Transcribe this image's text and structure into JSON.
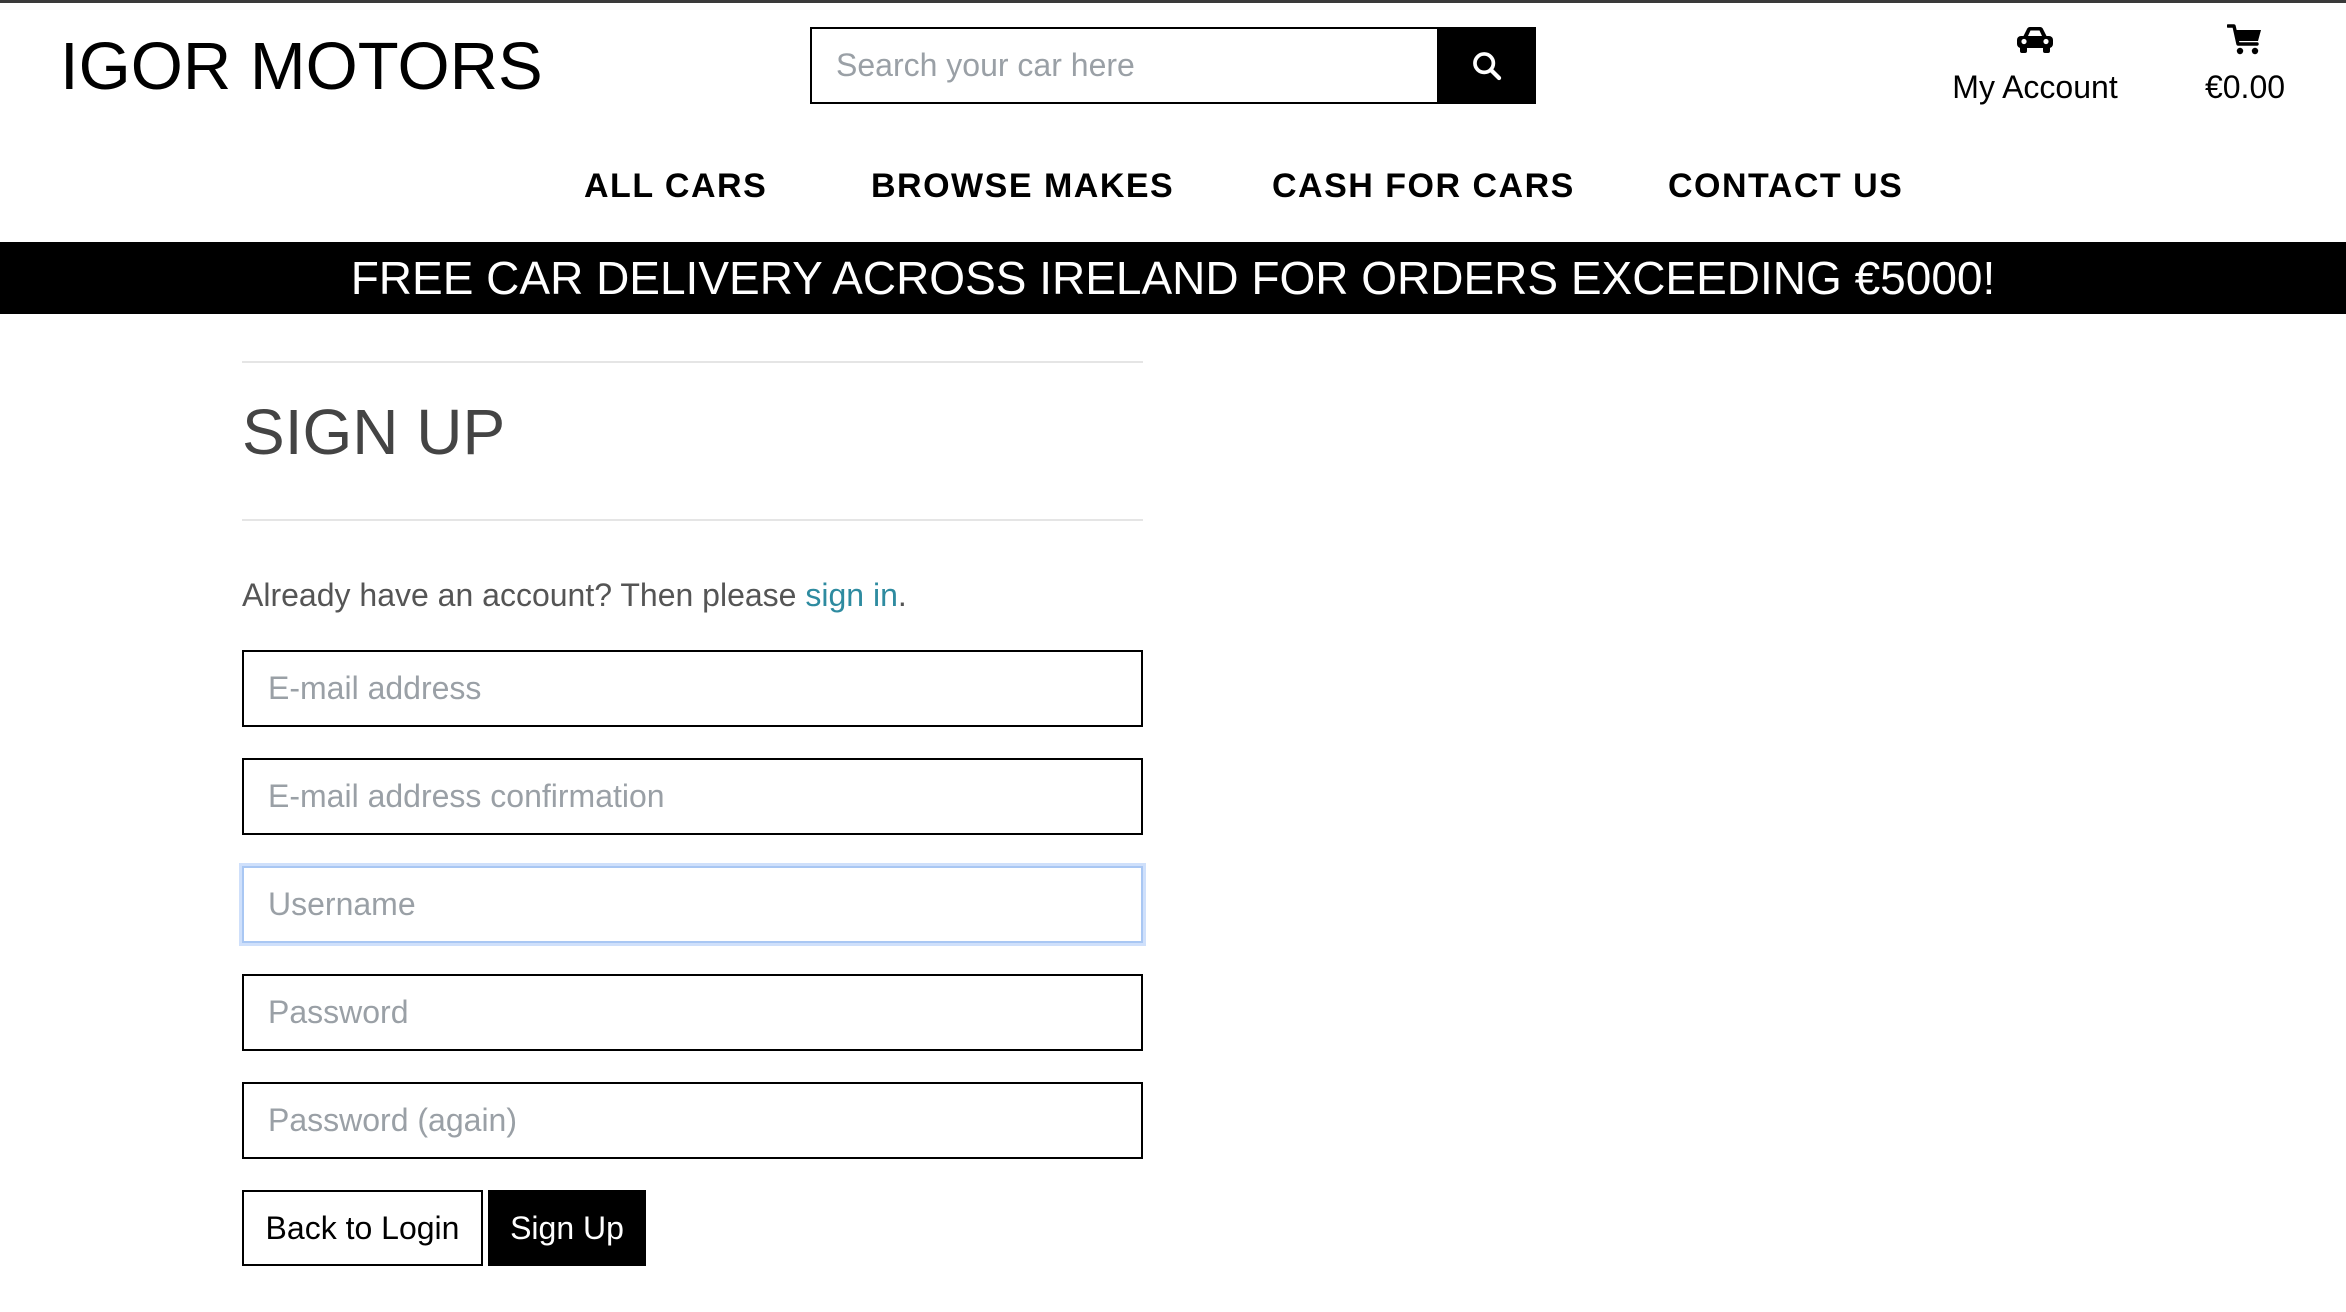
{
  "header": {
    "logo": "IGOR MOTORS",
    "search": {
      "placeholder": "Search your car here"
    },
    "account_label": "My Account",
    "cart_total": "€0.00"
  },
  "nav": {
    "items": [
      {
        "label": "ALL CARS"
      },
      {
        "label": "BROWSE MAKES"
      },
      {
        "label": "CASH FOR CARS"
      },
      {
        "label": "CONTACT US"
      }
    ]
  },
  "banner": {
    "text": "FREE CAR DELIVERY ACROSS IRELAND FOR ORDERS EXCEEDING €5000!"
  },
  "signup": {
    "heading": "SIGN UP",
    "intro_text": "Already have an account? Then please ",
    "intro_link": "sign in",
    "intro_end": ".",
    "fields": {
      "email": {
        "placeholder": "E-mail address"
      },
      "email_confirm": {
        "placeholder": "E-mail address confirmation"
      },
      "username": {
        "placeholder": "Username"
      },
      "password": {
        "placeholder": "Password"
      },
      "password_again": {
        "placeholder": "Password (again)"
      }
    },
    "back_button": "Back to Login",
    "submit_button": "Sign Up"
  },
  "icons": {
    "search": "search-icon",
    "account": "car-icon",
    "cart": "cart-icon"
  }
}
